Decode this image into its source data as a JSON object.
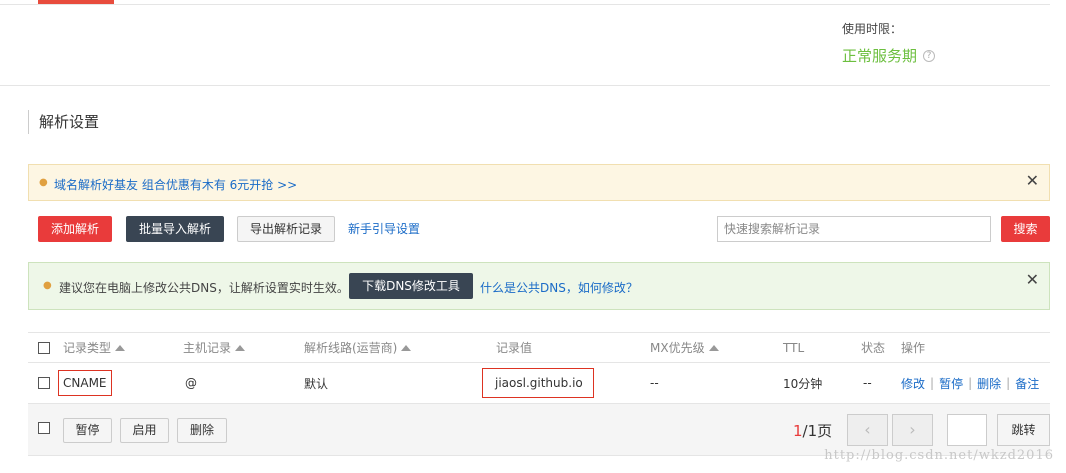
{
  "usage": {
    "label": "使用时限：",
    "status": "正常服务期",
    "status_color": "#6cbf3f"
  },
  "section": {
    "title": "解析设置"
  },
  "promo": {
    "text": "域名解析好基友 组合优惠有木有 6元开抢 >>"
  },
  "toolbar": {
    "add_label": "添加解析",
    "import_label": "批量导入解析",
    "export_label": "导出解析记录",
    "guide_label": "新手引导设置",
    "search_placeholder": "快速搜索解析记录",
    "search_label": "搜索"
  },
  "dns_notice": {
    "text": "建议您在电脑上修改公共DNS，让解析设置实时生效。",
    "tool_label": "下载DNS修改工具",
    "question_link": "什么是公共DNS，如何修改？"
  },
  "table": {
    "headers": {
      "type": "记录类型",
      "host": "主机记录",
      "line": "解析线路(运营商)",
      "value": "记录值",
      "mx": "MX优先级",
      "ttl": "TTL",
      "status": "状态",
      "ops": "操作"
    },
    "rows": [
      {
        "type": "CNAME",
        "host": "@",
        "line": "默认",
        "value": "jiaosl.github.io",
        "mx": "--",
        "ttl": "10分钟",
        "status": "--",
        "op_edit": "修改",
        "op_pause": "暂停",
        "op_delete": "删除",
        "op_note": "备注"
      }
    ]
  },
  "footer": {
    "pause_label": "暂停",
    "enable_label": "启用",
    "delete_label": "删除",
    "page_current": "1",
    "page_rest": "/1页",
    "prev_icon": "‹",
    "next_icon": "›",
    "jump_label": "跳转"
  },
  "watermark": "http://blog.csdn.net/wkzd2016",
  "colors": {
    "primary_red": "#e93b3b",
    "dark_button": "#394553",
    "link_blue": "#1a6bc7"
  }
}
